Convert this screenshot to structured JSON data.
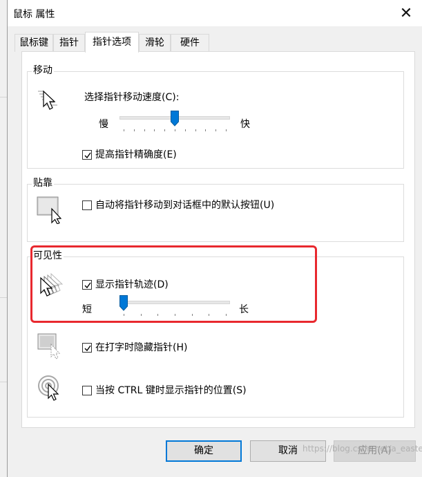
{
  "window": {
    "title": "鼠标 属性"
  },
  "tabs": [
    "鼠标键",
    "指针",
    "指针选项",
    "滑轮",
    "硬件"
  ],
  "motion": {
    "title": "移动",
    "speed_label": "选择指针移动速度(C):",
    "slow": "慢",
    "fast": "快",
    "speed_value_fraction": 0.5,
    "precision_label": "提高指针精确度(E)",
    "precision_checked": true
  },
  "snap": {
    "title": "贴靠",
    "snap_label": "自动将指针移动到对话框中的默认按钮(U)",
    "snap_checked": false
  },
  "visibility": {
    "title": "可见性",
    "trails_label": "显示指针轨迹(D)",
    "trails_checked": true,
    "short": "短",
    "long": "长",
    "trails_value_fraction": 0.0,
    "hide_label": "在打字时隐藏指针(H)",
    "hide_checked": true,
    "ctrl_label": "当按 CTRL 键时显示指针的位置(S)",
    "ctrl_checked": false
  },
  "buttons": {
    "ok": "确定",
    "cancel": "取消",
    "apply": "应用(A)"
  },
  "watermark": "https://blog.csdn.net/a_eastern",
  "colors": {
    "accent": "#0078d7",
    "highlight": "#e8282e"
  }
}
